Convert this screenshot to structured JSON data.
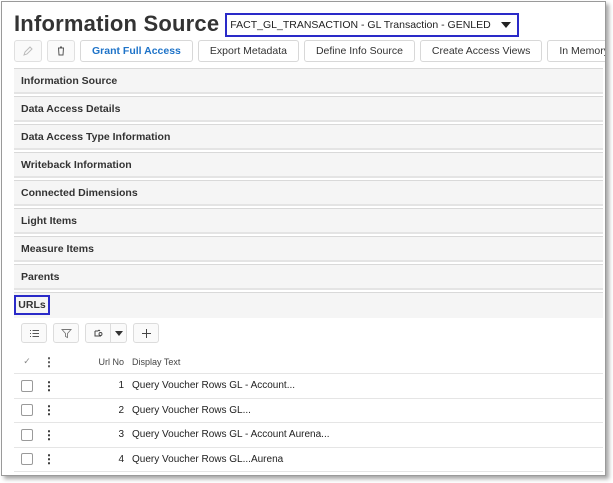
{
  "header": {
    "title": "Information Source",
    "selector_value": "FACT_GL_TRANSACTION - GL Transaction - GENLED"
  },
  "toolbar": {
    "edit_icon": "pencil-icon",
    "delete_icon": "trash-icon",
    "buttons": [
      "Grant Full Access",
      "Export Metadata",
      "Define Info Source",
      "Create Access Views",
      "In Memory Settings"
    ]
  },
  "sections": [
    "Information Source",
    "Data Access Details",
    "Data Access Type Information",
    "Writeback Information",
    "Connected Dimensions",
    "Light Items",
    "Measure Items",
    "Parents"
  ],
  "urls": {
    "label": "URLs",
    "toolbar_icons": [
      "list-icon",
      "filter-icon",
      "settings-icon",
      "add-icon"
    ],
    "columns": {
      "check": "✓",
      "url_no": "Url No",
      "display_text": "Display Text"
    },
    "rows": [
      {
        "url_no": "1",
        "display_text": "Query Voucher Rows GL - Account..."
      },
      {
        "url_no": "2",
        "display_text": "Query Voucher Rows GL..."
      },
      {
        "url_no": "3",
        "display_text": "Query Voucher Rows GL - Account Aurena..."
      },
      {
        "url_no": "4",
        "display_text": "Query Voucher Rows GL...Aurena"
      }
    ]
  },
  "colors": {
    "accent": "#1e73c8",
    "highlight_border": "#2a2ac8"
  }
}
